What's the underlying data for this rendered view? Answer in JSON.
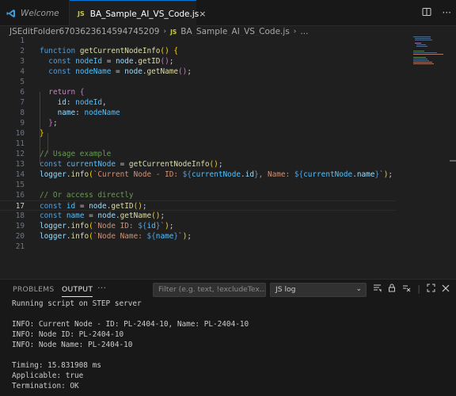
{
  "tabs": {
    "welcome_label": "Welcome",
    "active_badge": "JS",
    "active_label": "BA_Sample_AI_VS_Code.js",
    "active_close": "×"
  },
  "breadcrumbs": {
    "folder": "JSEditFolder6703623614594745209",
    "file_badge": "JS",
    "file": "BA_Sample_AI_VS_Code.js",
    "more": "..."
  },
  "editor": {
    "current_line": 17,
    "lines": [
      "1",
      "2",
      "3",
      "4",
      "5",
      "6",
      "7",
      "8",
      "9",
      "10",
      "11",
      "12",
      "13",
      "14",
      "15",
      "16",
      "17",
      "18",
      "19",
      "20",
      "21"
    ]
  },
  "panel": {
    "problems_label": "PROBLEMS",
    "output_label": "OUTPUT",
    "more_label": "···",
    "filter_placeholder": "Filter (e.g. text, !excludeTex...",
    "channel": "JS log",
    "output_lines": [
      "Running script on STEP server",
      "",
      "INFO: Current Node - ID: PL-2404-10, Name: PL-2404-10",
      "INFO: Node ID: PL-2404-10",
      "INFO: Node Name: PL-2404-10",
      "",
      "Timing: 15.831908 ms",
      "Applicable: true",
      "Termination: OK"
    ]
  },
  "colors": {
    "background": "#1f1f1f",
    "tabbar": "#181818",
    "accent": "#0078d4",
    "js_badge": "#cbcb41"
  },
  "icons": [
    "vscode-logo-icon",
    "split-editor-icon",
    "more-actions-icon",
    "list-filter-icon",
    "lock-scroll-icon",
    "clear-output-icon",
    "maximize-panel-icon",
    "close-panel-icon"
  ]
}
